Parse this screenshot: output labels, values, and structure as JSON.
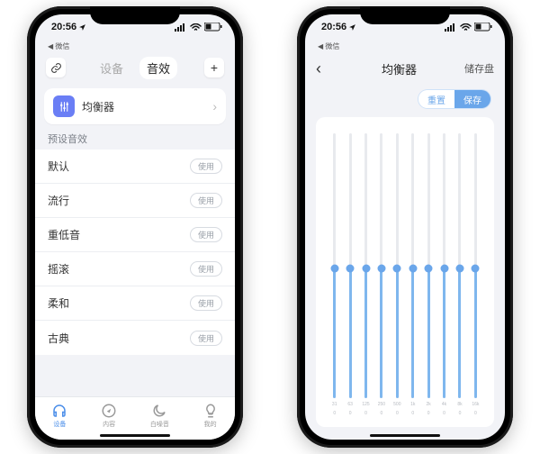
{
  "status": {
    "time": "20:56",
    "carrier": "微信",
    "battery": "40"
  },
  "left": {
    "tabs": {
      "device": "设备",
      "sound": "音效"
    },
    "eq_entry": "均衡器",
    "section": "预设音效",
    "use_label": "使用",
    "presets": [
      "默认",
      "流行",
      "重低音",
      "摇滚",
      "柔和",
      "古典"
    ],
    "tabbar": {
      "device": "设备",
      "content": "内容",
      "noise": "白噪音",
      "mine": "我的"
    }
  },
  "right": {
    "title": "均衡器",
    "save_slot": "储存盘",
    "reset": "重置",
    "save": "保存",
    "bands": [
      {
        "freq": "31",
        "val": 0,
        "pct": 49
      },
      {
        "freq": "63",
        "val": 0,
        "pct": 49
      },
      {
        "freq": "125",
        "val": 0,
        "pct": 49
      },
      {
        "freq": "250",
        "val": 0,
        "pct": 49
      },
      {
        "freq": "500",
        "val": 0,
        "pct": 49
      },
      {
        "freq": "1k",
        "val": 0,
        "pct": 49
      },
      {
        "freq": "2k",
        "val": 0,
        "pct": 49
      },
      {
        "freq": "4k",
        "val": 0,
        "pct": 49
      },
      {
        "freq": "8k",
        "val": 0,
        "pct": 49
      },
      {
        "freq": "16k",
        "val": 0,
        "pct": 49
      }
    ]
  }
}
